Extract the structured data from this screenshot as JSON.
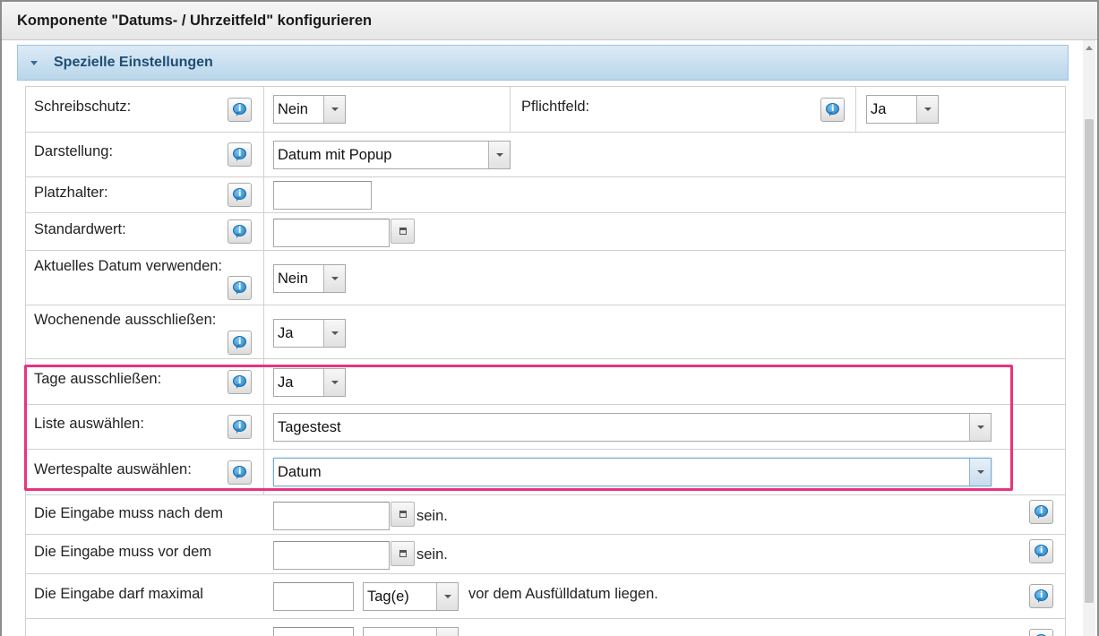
{
  "window": {
    "title": "Komponente \"Datums- / Uhrzeitfeld\" konfigurieren"
  },
  "section": {
    "label": "Spezielle Einstellungen"
  },
  "info_glyph": "i",
  "rows": {
    "schreibschutz": {
      "label": "Schreibschutz:",
      "value": "Nein"
    },
    "pflichtfeld": {
      "label": "Pflichtfeld:",
      "value": "Ja"
    },
    "darstellung": {
      "label": "Darstellung:",
      "value": "Datum mit Popup"
    },
    "platzhalter": {
      "label": "Platzhalter:",
      "value": ""
    },
    "standardwert": {
      "label": "Standardwert:",
      "value": ""
    },
    "aktuelles_datum": {
      "label": "Aktuelles Datum verwenden:",
      "value": "Nein"
    },
    "wochenende": {
      "label": "Wochenende ausschließen:",
      "value": "Ja"
    },
    "tage": {
      "label": "Tage ausschließen:",
      "value": "Ja"
    },
    "liste": {
      "label": "Liste auswählen:",
      "value": "Tagestest"
    },
    "wertespalte": {
      "label": "Wertespalte auswählen:",
      "value": "Datum"
    },
    "nach_dem": {
      "label": "Die Eingabe muss nach dem",
      "value": "",
      "suffix": "sein."
    },
    "vor_dem": {
      "label": "Die Eingabe muss vor dem",
      "value": "",
      "suffix": "sein."
    },
    "maximal": {
      "label": "Die Eingabe darf maximal",
      "value": "",
      "unit": "Tag(e)",
      "suffix": "vor dem Ausfülldatum liegen."
    }
  },
  "colors": {
    "highlight": "#e8337f",
    "section_text": "#1f4d74",
    "section_bg": "#c9e0f0"
  },
  "icons": [
    "info-icon",
    "calendar-icon",
    "dropdown-arrow-icon",
    "collapse-caret-icon"
  ]
}
